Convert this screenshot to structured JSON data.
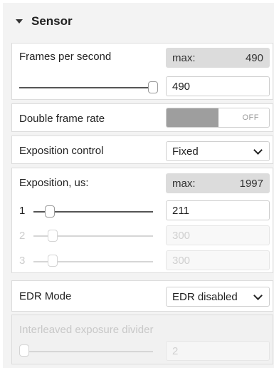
{
  "section": {
    "title": "Sensor",
    "collapse_icon": "caret-down-icon"
  },
  "fps": {
    "label": "Frames per second",
    "max_key": "max:",
    "max_value": "490",
    "value": "490",
    "slider_fraction": 1.0
  },
  "double_rate": {
    "label": "Double frame rate",
    "state": "OFF"
  },
  "exposition_control": {
    "label": "Exposition control",
    "selected": "Fixed"
  },
  "exposition": {
    "label": "Exposition, us:",
    "max_key": "max:",
    "max_value": "1997",
    "rows": [
      {
        "index": "1",
        "value": "211",
        "enabled": true
      },
      {
        "index": "2",
        "value": "300",
        "enabled": false
      },
      {
        "index": "3",
        "value": "300",
        "enabled": false
      }
    ]
  },
  "edr": {
    "label": "EDR Mode",
    "selected": "EDR disabled"
  },
  "interleaved": {
    "label": "Interleaved exposure divider",
    "value": "2",
    "slider_fraction": 0.0
  },
  "colors": {
    "panel_bg": "#f3f3f3",
    "toggle_knob": "#9e9e9e",
    "max_box": "#dcdcdc"
  }
}
